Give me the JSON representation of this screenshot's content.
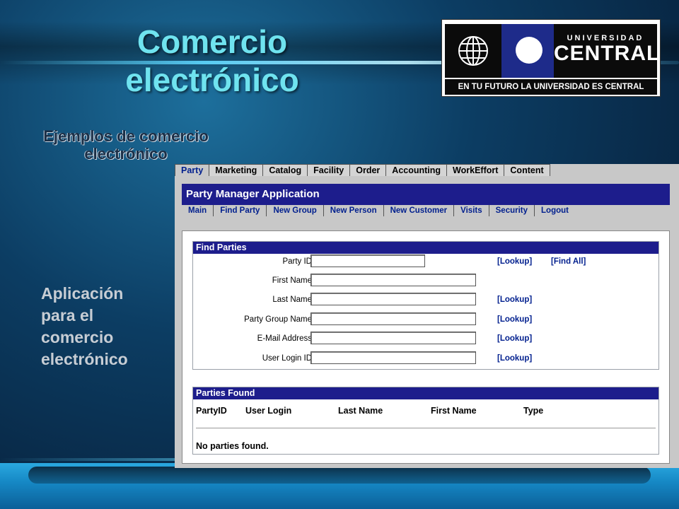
{
  "slide": {
    "title": "Comercio electrónico",
    "subtitle": "Ejemplos de comercio electrónico",
    "side_text": "Aplicación para el comercio electrónico"
  },
  "logo": {
    "name_top": "UNIVERSIDAD",
    "name_main": "CENTRAL",
    "tagline": "EN TU FUTURO LA UNIVERSIDAD ES CENTRAL",
    "icon": "globe-icon"
  },
  "app": {
    "tabs": [
      "Party",
      "Marketing",
      "Catalog",
      "Facility",
      "Order",
      "Accounting",
      "WorkEffort",
      "Content"
    ],
    "active_tab": "Party",
    "header_title": "Party Manager Application",
    "subnav": [
      "Main",
      "Find Party",
      "New Group",
      "New Person",
      "New Customer",
      "Visits",
      "Security",
      "Logout"
    ],
    "find_box": {
      "title": "Find Parties",
      "fields": [
        {
          "label": "Party ID",
          "value": "",
          "lookup": "[Lookup]",
          "extra": "[Find All]"
        },
        {
          "label": "First Name",
          "value": "",
          "lookup": "",
          "extra": ""
        },
        {
          "label": "Last Name",
          "value": "",
          "lookup": "[Lookup]",
          "extra": ""
        },
        {
          "label": "Party Group Name",
          "value": "",
          "lookup": "[Lookup]",
          "extra": ""
        },
        {
          "label": "E-Mail Address",
          "value": "",
          "lookup": "[Lookup]",
          "extra": ""
        },
        {
          "label": "User Login ID",
          "value": "",
          "lookup": "[Lookup]",
          "extra": ""
        }
      ]
    },
    "results_box": {
      "title": "Parties Found",
      "columns": [
        "PartyID",
        "User Login",
        "Last Name",
        "First Name",
        "Type"
      ],
      "empty_message": "No parties found."
    }
  }
}
